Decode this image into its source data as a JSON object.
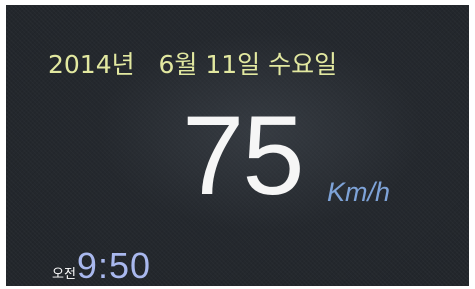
{
  "dashboard": {
    "date": "2014년   6월 11일 수요일",
    "speed": "75",
    "speed_unit": "Km/h",
    "ampm": "오전",
    "time": "9:50"
  },
  "colors": {
    "date_text": "#e2e8a0",
    "speed_text": "#f6f6f6",
    "unit_text": "#7ea3d8",
    "time_text": "#a9b8ee",
    "background": "#23272c"
  }
}
